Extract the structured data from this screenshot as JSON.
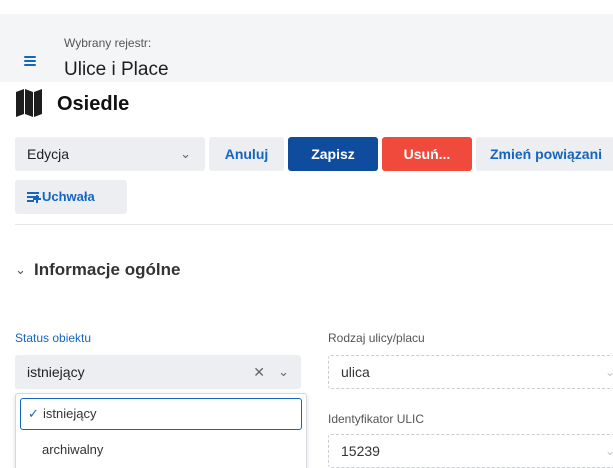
{
  "header": {
    "registry_caption": "Wybrany rejestr:",
    "registry_name": "Ulice i Place"
  },
  "page": {
    "title": "Osiedle",
    "title_icon": "map-icon"
  },
  "toolbar": {
    "mode_value": "Edycja",
    "cancel_label": "Anuluj",
    "save_label": "Zapisz",
    "delete_label": "Usuń...",
    "relations_label": "Zmień powiązani",
    "resolution_label": "Uchwała"
  },
  "section": {
    "title": "Informacje ogólne"
  },
  "form": {
    "status": {
      "label": "Status obiektu",
      "value": "istniejący",
      "options": [
        {
          "label": "istniejący",
          "selected": true
        },
        {
          "label": "archiwalny",
          "selected": false
        }
      ]
    },
    "street_type": {
      "label": "Rodzaj ulicy/placu",
      "value": "ulica"
    },
    "ulic_id": {
      "label": "Identyfikator ULIC",
      "value": "15239"
    }
  },
  "colors": {
    "accent": "#1565c0",
    "primary_button": "#0f4c9e",
    "danger_button": "#f04a3d",
    "header_bg": "#f4f5f7",
    "control_bg": "#eceef1"
  }
}
